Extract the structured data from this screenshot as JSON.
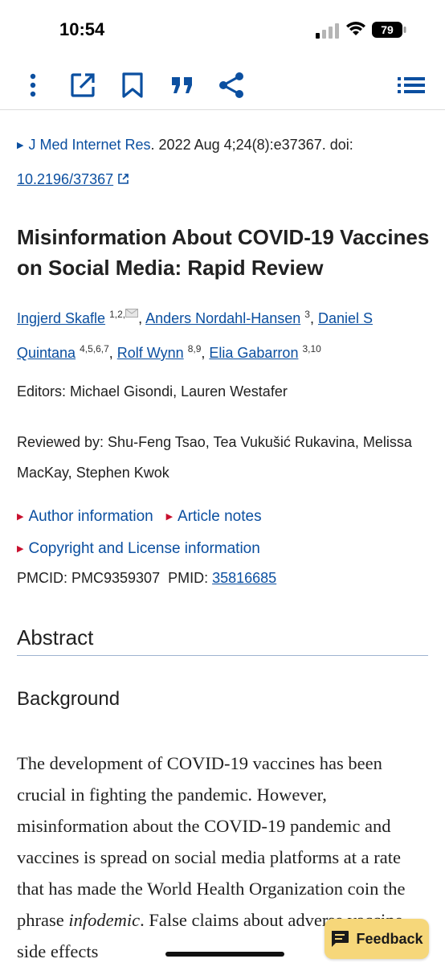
{
  "status": {
    "time": "10:54",
    "battery": "79"
  },
  "toolbar": {
    "icons": [
      "more-vertical-icon",
      "open-external-icon",
      "bookmark-icon",
      "cite-quote-icon",
      "share-icon",
      "menu-list-icon"
    ],
    "accent": "#0b4fa0"
  },
  "citation": {
    "journal": "J Med Internet Res",
    "details": ". 2022 Aug 4;24(8):e37367. doi: ",
    "doi": "10.2196/37367"
  },
  "article": {
    "title": "Misinformation About COVID-19 Vaccines on Social Media: Rapid Review",
    "authors": [
      {
        "name": "Ingjerd Skafle",
        "sup": "1,2,"
      },
      {
        "name": "Anders Nordahl-Hansen",
        "sup": "3"
      },
      {
        "name": "Daniel S Quintana",
        "sup": "4,5,6,7"
      },
      {
        "name": "Rolf Wynn",
        "sup": "8,9"
      },
      {
        "name": "Elia Gabarron",
        "sup": "3,10"
      }
    ],
    "editors": "Editors: Michael Gisondi, Lauren Westafer",
    "reviewed": "Reviewed by: Shu-Feng Tsao, Tea Vukušić Rukavina, Melissa MacKay, Stephen Kwok",
    "author_info": "Author information",
    "article_notes": "Article notes",
    "copyright": "Copyright and License information",
    "pmcid": "PMCID: PMC9359307",
    "pmid_label": "PMID: ",
    "pmid": "35816685"
  },
  "abstract": {
    "heading": "Abstract",
    "section": "Background",
    "text_before": "The development of COVID-19 vaccines has been crucial in fighting the pandemic. However, misinformation about the COVID-19 pandemic and vaccines is spread on social media platforms at a rate that has made the World Health Organization coin the phrase ",
    "text_em": "infodemic",
    "text_after": ". False claims about adverse vaccine side effects"
  },
  "feedback": {
    "label": "Feedback"
  }
}
